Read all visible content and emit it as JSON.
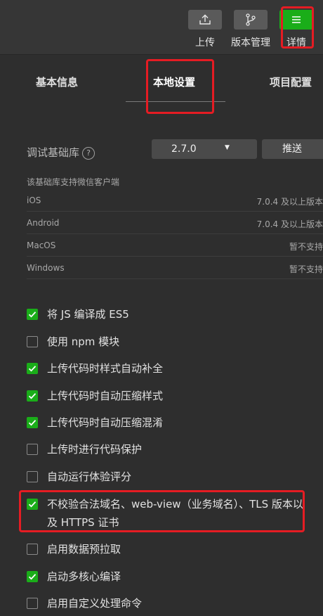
{
  "toolbar": {
    "upload_label": "上传",
    "version_label": "版本管理",
    "details_label": "详情"
  },
  "tabs": [
    {
      "label": "基本信息"
    },
    {
      "label": "本地设置",
      "active": true
    },
    {
      "label": "项目配置"
    }
  ],
  "debug_lib": {
    "label": "调试基础库",
    "help": "?",
    "selected": "2.7.0",
    "push_label": "推送"
  },
  "support": {
    "note": "该基础库支持微信客户端",
    "rows": [
      {
        "os": "iOS",
        "version": "7.0.4 及以上版本"
      },
      {
        "os": "Android",
        "version": "7.0.4 及以上版本"
      },
      {
        "os": "MacOS",
        "version": "暂不支持"
      },
      {
        "os": "Windows",
        "version": "暂不支持"
      }
    ]
  },
  "options": [
    {
      "label": "将 JS 编译成 ES5",
      "checked": true
    },
    {
      "label": "使用 npm 模块",
      "checked": false
    },
    {
      "label": "上传代码时样式自动补全",
      "checked": true
    },
    {
      "label": "上传代码时自动压缩样式",
      "checked": true
    },
    {
      "label": "上传代码时自动压缩混淆",
      "checked": true
    },
    {
      "label": "上传时进行代码保护",
      "checked": false
    },
    {
      "label": "自动运行体验评分",
      "checked": false
    },
    {
      "label": "不校验合法域名、web-view（业务域名）、TLS 版本以及 HTTPS 证书",
      "checked": true
    },
    {
      "label": "启用数据预拉取",
      "checked": false
    },
    {
      "label": "启动多核心编译",
      "checked": true
    },
    {
      "label": "启用自定义处理命令",
      "checked": false
    }
  ],
  "colors": {
    "accent_green": "#1aad19",
    "highlight_red": "#e51c23",
    "background": "#2e2e2e"
  }
}
